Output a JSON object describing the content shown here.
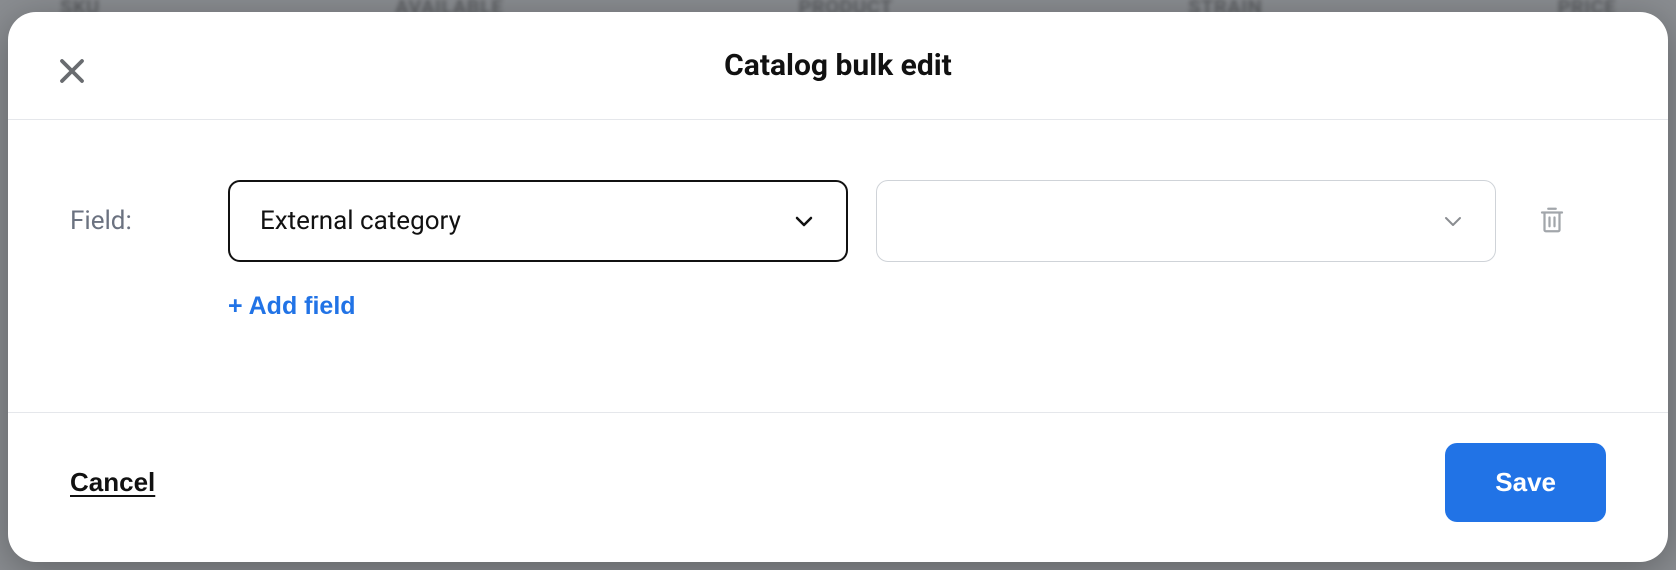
{
  "backdrop": {
    "columns": [
      "SKU",
      "AVAILABLE",
      "PRODUCT",
      "STRAIN",
      "PRICE"
    ]
  },
  "modal": {
    "title": "Catalog bulk edit",
    "field_label": "Field:",
    "field_select_value": "External category",
    "value_select_value": "",
    "add_field_label": "+ Add field",
    "cancel_label": "Cancel",
    "save_label": "Save"
  }
}
